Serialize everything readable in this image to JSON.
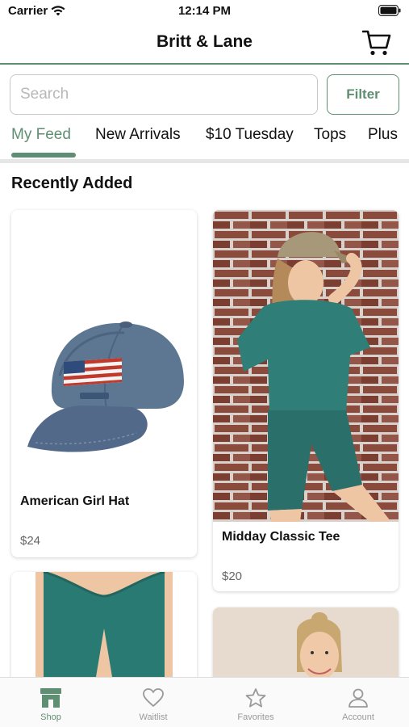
{
  "status_bar": {
    "carrier": "Carrier",
    "time": "12:14 PM"
  },
  "header": {
    "title": "Britt & Lane"
  },
  "search": {
    "placeholder": "Search",
    "filter_label": "Filter"
  },
  "tabs": [
    {
      "label": "My Feed",
      "active": true
    },
    {
      "label": "New Arrivals"
    },
    {
      "label": "$10 Tuesday"
    },
    {
      "label": "Tops"
    },
    {
      "label": "Plus"
    }
  ],
  "section": {
    "title": "Recently Added"
  },
  "products": [
    {
      "name": "American Girl Hat",
      "price": "$24"
    },
    {
      "name": "Midday Classic Tee",
      "price": "$20"
    }
  ],
  "tab_bar": [
    {
      "label": "Shop",
      "icon": "shop-icon",
      "active": true
    },
    {
      "label": "Waitlist",
      "icon": "heart-icon"
    },
    {
      "label": "Favorites",
      "icon": "star-icon"
    },
    {
      "label": "Account",
      "icon": "person-icon"
    }
  ],
  "colors": {
    "accent": "#5f8f72",
    "muted": "#999999"
  }
}
